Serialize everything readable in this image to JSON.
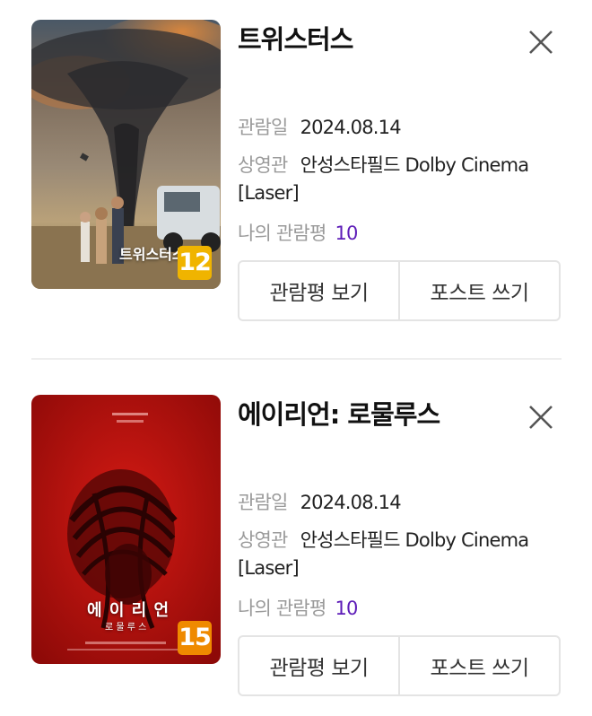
{
  "labels": {
    "date": "관람일",
    "theater": "상영관",
    "my_review": "나의 관람평",
    "view_review_button": "관람평 보기",
    "write_post_button": "포스트 쓰기"
  },
  "movies": [
    {
      "title": "트위스터스",
      "date": "2024.08.14",
      "theater_line1": "안성스타필드 Dolby Cinema",
      "theater_line2": "[Laser]",
      "rating": "10",
      "age_badge": "12",
      "age_badge_color": "#f0b400",
      "poster_title": "트위스터스"
    },
    {
      "title": "에이리언: 로물루스",
      "date": "2024.08.14",
      "theater_line1": "안성스타필드 Dolby Cinema",
      "theater_line2": "[Laser]",
      "rating": "10",
      "age_badge": "15",
      "age_badge_color": "#ef8a00",
      "poster_title": "에 이 리 언",
      "poster_subtitle": "로 물 루 스"
    }
  ],
  "colors": {
    "rating": "#5d1cb8",
    "label": "#9a9a9a",
    "border": "#e4e4e4"
  }
}
